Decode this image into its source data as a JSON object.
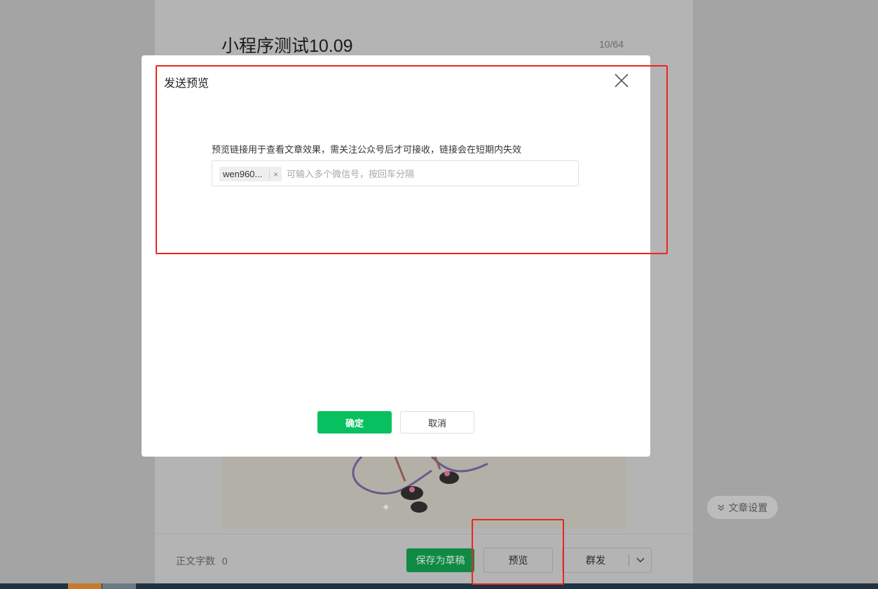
{
  "editor": {
    "article_title": "小程序测试10.09",
    "title_count": "10/64",
    "word_count_label": "正文字数",
    "word_count_value": "0",
    "buttons": {
      "save_draft": "保存为草稿",
      "preview": "预览",
      "mass_send": "群发"
    },
    "settings_label": "文章设置"
  },
  "modal": {
    "title": "发送预览",
    "description": "预览链接用于查看文章效果，需关注公众号后才可接收，链接会在短期内失效",
    "recipient_chips": [
      "wen960..."
    ],
    "recipient_placeholder": "可输入多个微信号，按回车分隔",
    "confirm_label": "确定",
    "cancel_label": "取消"
  },
  "colors": {
    "primary_green": "#07c160",
    "annotation_red": "#e8281d"
  }
}
